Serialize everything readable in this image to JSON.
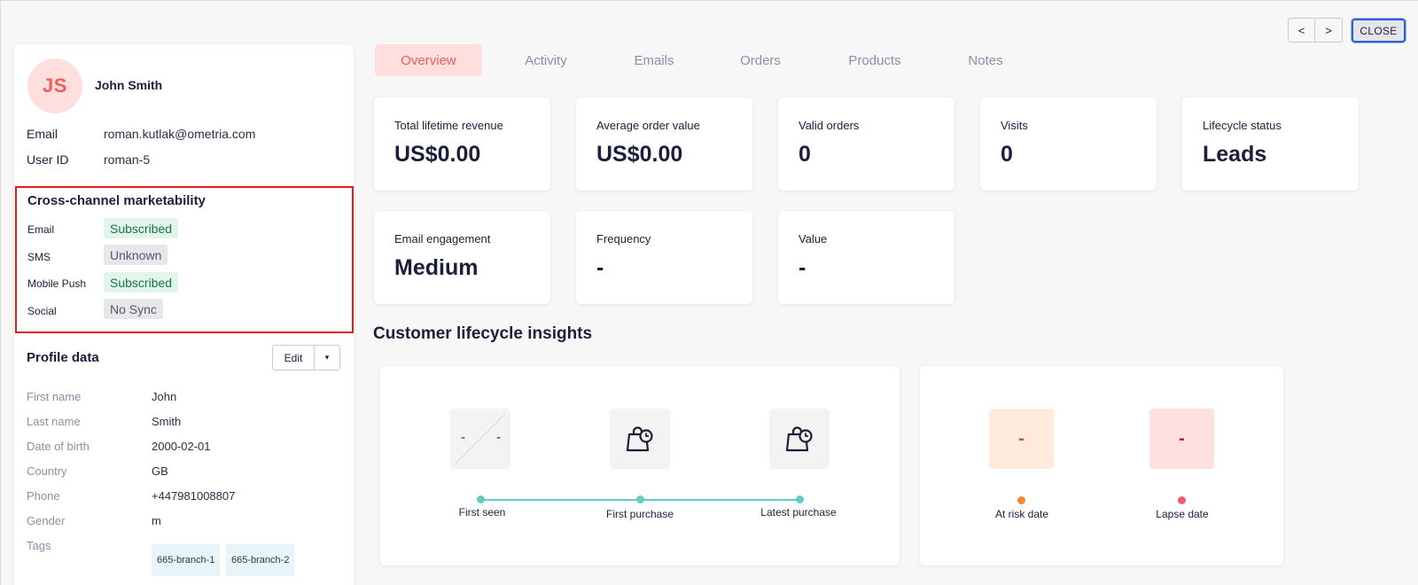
{
  "nav": {
    "prev_label": "<",
    "next_label": ">",
    "close_label": "CLOSE"
  },
  "profile": {
    "initials": "JS",
    "name": "John Smith",
    "email_label": "Email",
    "email": "roman.kutlak@ometria.com",
    "user_id_label": "User ID",
    "user_id": "roman-5"
  },
  "marketability": {
    "title": "Cross-channel marketability",
    "channels": [
      {
        "label": "Email",
        "status": "Subscribed"
      },
      {
        "label": "SMS",
        "status": "Unknown"
      },
      {
        "label": "Mobile Push",
        "status": "Subscribed"
      },
      {
        "label": "Social",
        "status": "No Sync"
      }
    ]
  },
  "profile_data": {
    "title": "Profile data",
    "edit_label": "Edit",
    "caret": "▾",
    "fields": [
      {
        "label": "First name",
        "value": "John"
      },
      {
        "label": "Last name",
        "value": "Smith"
      },
      {
        "label": "Date of birth",
        "value": "2000-02-01"
      },
      {
        "label": "Country",
        "value": "GB"
      },
      {
        "label": "Phone",
        "value": "+447981008807"
      },
      {
        "label": "Gender",
        "value": "m"
      }
    ],
    "tags_label": "Tags",
    "tags": [
      "665-branch-1",
      "665-branch-2"
    ]
  },
  "tabs": [
    "Overview",
    "Activity",
    "Emails",
    "Orders",
    "Products",
    "Notes"
  ],
  "metrics": [
    {
      "label": "Total lifetime revenue",
      "value": "US$0.00"
    },
    {
      "label": "Average order value",
      "value": "US$0.00"
    },
    {
      "label": "Valid orders",
      "value": "0"
    },
    {
      "label": "Visits",
      "value": "0"
    },
    {
      "label": "Lifecycle status",
      "value": "Leads"
    },
    {
      "label": "Email engagement",
      "value": "Medium"
    },
    {
      "label": "Frequency",
      "value": "-"
    },
    {
      "label": "Value",
      "value": "-"
    }
  ],
  "insights": {
    "title": "Customer lifecycle insights",
    "first_seen_left": "-",
    "first_seen_right": "-",
    "timeline": [
      "First seen",
      "First purchase",
      "Latest purchase"
    ],
    "at_risk_value": "-",
    "lapse_value": "-",
    "at_risk_label": "At risk date",
    "lapse_label": "Lapse date"
  }
}
